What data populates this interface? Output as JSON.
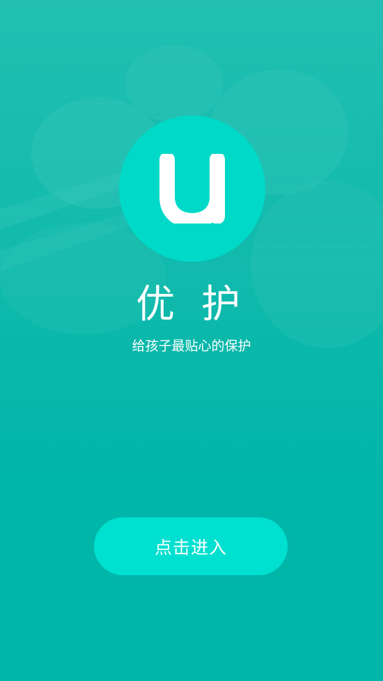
{
  "app": {
    "logo_letter": "u",
    "title": "优 护",
    "tagline": "给孩子最贴心的保护"
  },
  "actions": {
    "enter_label": "点击进入"
  },
  "colors": {
    "background": "#00b6a9",
    "logo_circle": "#00d9c8",
    "button": "#00e0d0",
    "text": "#ffffff"
  },
  "icons": {
    "logo": "u-letter-logo-icon"
  }
}
